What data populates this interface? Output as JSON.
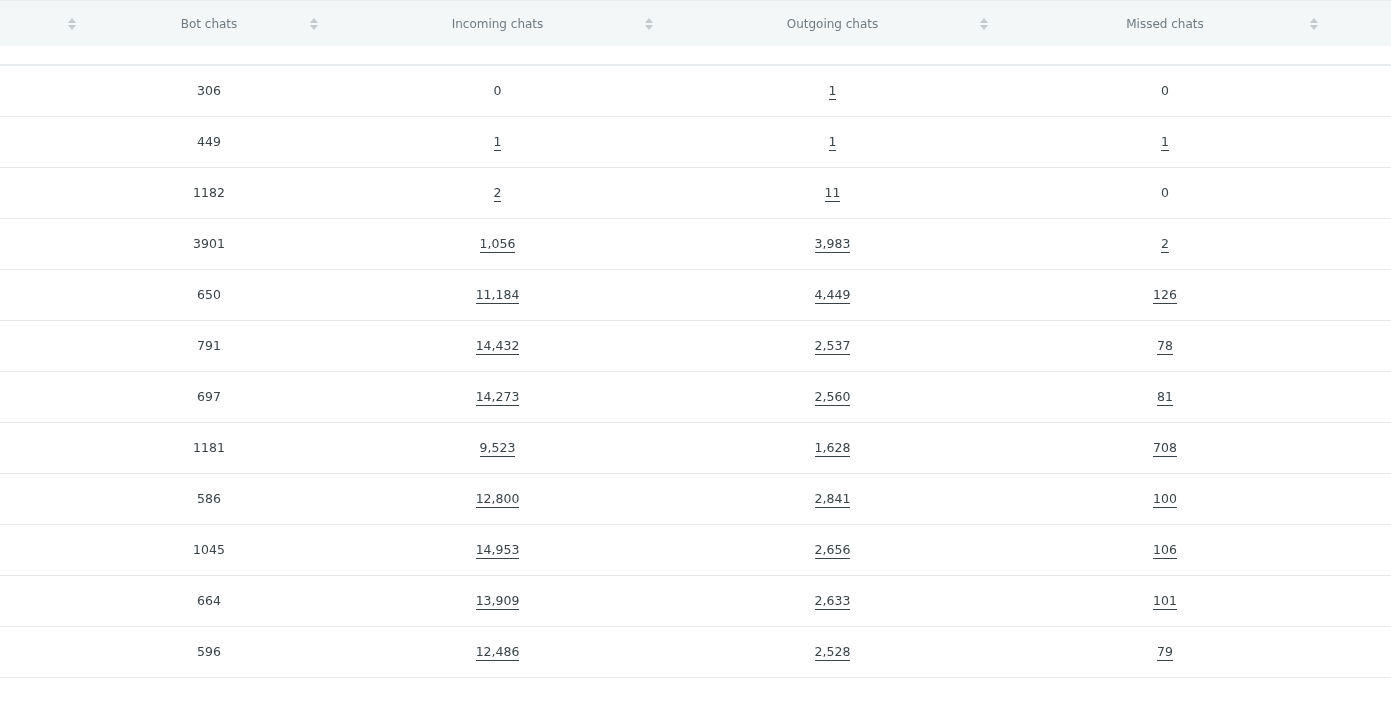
{
  "table": {
    "columns": [
      {
        "label": "Bot chats"
      },
      {
        "label": "Incoming chats"
      },
      {
        "label": "Outgoing chats"
      },
      {
        "label": "Missed chats"
      }
    ],
    "rows": [
      {
        "cells": [
          {
            "text": "306",
            "link": false
          },
          {
            "text": "0",
            "link": false
          },
          {
            "text": "1",
            "link": true
          },
          {
            "text": "0",
            "link": false
          }
        ]
      },
      {
        "cells": [
          {
            "text": "449",
            "link": false
          },
          {
            "text": "1",
            "link": true
          },
          {
            "text": "1",
            "link": true
          },
          {
            "text": "1",
            "link": true
          }
        ]
      },
      {
        "cells": [
          {
            "text": "1182",
            "link": false
          },
          {
            "text": "2",
            "link": true
          },
          {
            "text": "11",
            "link": true
          },
          {
            "text": "0",
            "link": false
          }
        ]
      },
      {
        "cells": [
          {
            "text": "3901",
            "link": false
          },
          {
            "text": "1,056",
            "link": true
          },
          {
            "text": "3,983",
            "link": true
          },
          {
            "text": "2",
            "link": true
          }
        ]
      },
      {
        "cells": [
          {
            "text": "650",
            "link": false
          },
          {
            "text": "11,184",
            "link": true
          },
          {
            "text": "4,449",
            "link": true
          },
          {
            "text": "126",
            "link": true
          }
        ]
      },
      {
        "cells": [
          {
            "text": "791",
            "link": false
          },
          {
            "text": "14,432",
            "link": true
          },
          {
            "text": "2,537",
            "link": true
          },
          {
            "text": "78",
            "link": true
          }
        ]
      },
      {
        "cells": [
          {
            "text": "697",
            "link": false
          },
          {
            "text": "14,273",
            "link": true
          },
          {
            "text": "2,560",
            "link": true
          },
          {
            "text": "81",
            "link": true
          }
        ]
      },
      {
        "cells": [
          {
            "text": "1181",
            "link": false
          },
          {
            "text": "9,523",
            "link": true
          },
          {
            "text": "1,628",
            "link": true
          },
          {
            "text": "708",
            "link": true
          }
        ]
      },
      {
        "cells": [
          {
            "text": "586",
            "link": false
          },
          {
            "text": "12,800",
            "link": true
          },
          {
            "text": "2,841",
            "link": true
          },
          {
            "text": "100",
            "link": true
          }
        ]
      },
      {
        "cells": [
          {
            "text": "1045",
            "link": false
          },
          {
            "text": "14,953",
            "link": true
          },
          {
            "text": "2,656",
            "link": true
          },
          {
            "text": "106",
            "link": true
          }
        ]
      },
      {
        "cells": [
          {
            "text": "664",
            "link": false
          },
          {
            "text": "13,909",
            "link": true
          },
          {
            "text": "2,633",
            "link": true
          },
          {
            "text": "101",
            "link": true
          }
        ]
      },
      {
        "cells": [
          {
            "text": "596",
            "link": false
          },
          {
            "text": "12,486",
            "link": true
          },
          {
            "text": "2,528",
            "link": true
          },
          {
            "text": "79",
            "link": true
          }
        ]
      }
    ]
  }
}
